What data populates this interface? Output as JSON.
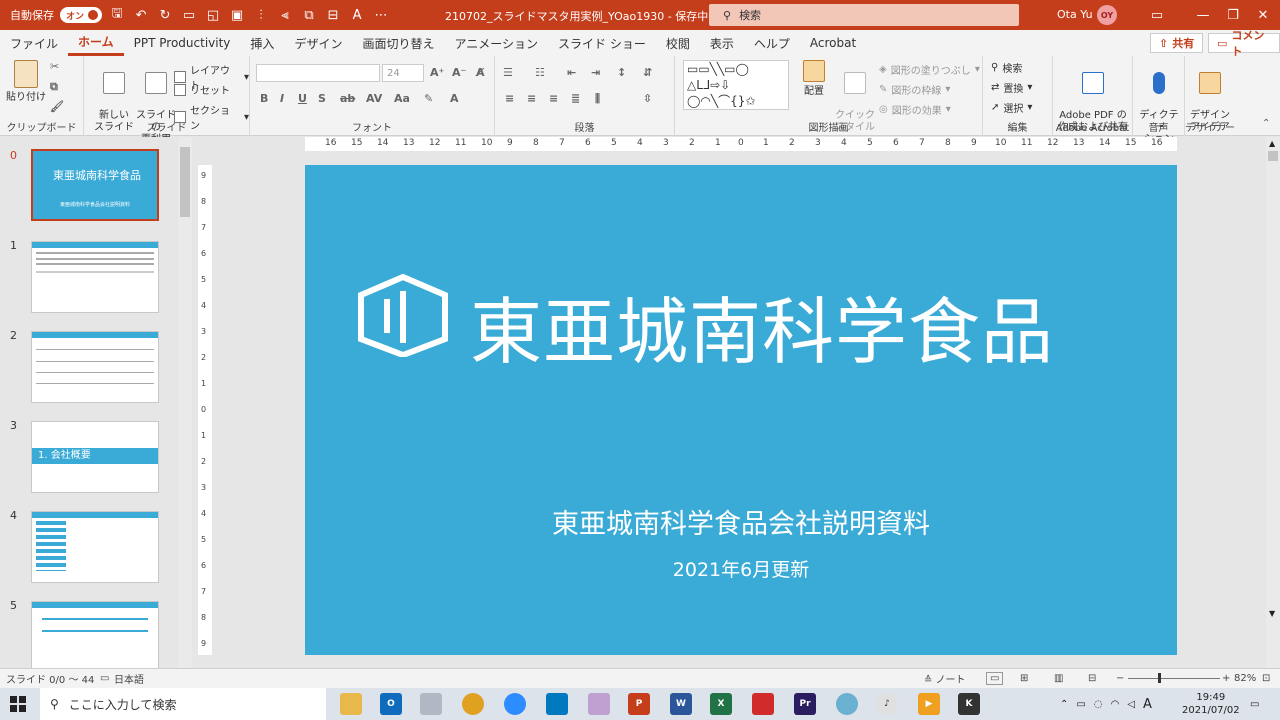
{
  "titlebar": {
    "autosave_label": "自動保存",
    "autosave_state": "オン",
    "doc_title": "210702_スライドマスタ用実例_YOao1930 - 保存中... ▾",
    "search_placeholder": "検索",
    "user_name": "Ota Yu",
    "user_initials": "OY"
  },
  "tabs": [
    "ファイル",
    "ホーム",
    "PPT Productivity",
    "挿入",
    "デザイン",
    "画面切り替え",
    "アニメーション",
    "スライド ショー",
    "校閲",
    "表示",
    "ヘルプ",
    "Acrobat"
  ],
  "share_label": "共有",
  "comment_label": "コメント",
  "ribbon": {
    "clipboard": {
      "paste": "貼り付け",
      "label": "クリップボード"
    },
    "slides": {
      "new_slide": "新しい\nスライド",
      "reuse": "スライドの\n再利用",
      "layout": "レイアウト",
      "reset": "リセット",
      "section": "セクション",
      "label": "スライド"
    },
    "font": {
      "size": "24",
      "label": "フォント"
    },
    "paragraph": {
      "label": "段落"
    },
    "drawing": {
      "arrange": "配置",
      "quick_style": "クイック\nスタイル",
      "fill": "図形の塗りつぶし",
      "outline": "図形の枠線",
      "effect": "図形の効果",
      "label": "図形描画"
    },
    "editing": {
      "find": "検索",
      "replace": "置換",
      "select": "選択",
      "label": "編集"
    },
    "acrobat": {
      "create": "Adobe PDF の\n作成および共有",
      "label": "Adobe Acrobat"
    },
    "voice": {
      "dictate": "ディクテー\nション",
      "label": "音声"
    },
    "designer": {
      "ideas": "デザイン\nアイデア",
      "label": "デザイナー"
    }
  },
  "thumbnails": [
    {
      "num": "0",
      "title": "東亜城南科学食品",
      "sub": "東亜城南科学食品会社説明資料"
    },
    {
      "num": "1"
    },
    {
      "num": "2"
    },
    {
      "num": "3",
      "title": "1. 会社概要"
    },
    {
      "num": "4"
    },
    {
      "num": "5"
    }
  ],
  "ruler_h": [
    "16",
    "15",
    "14",
    "13",
    "12",
    "11",
    "10",
    "9",
    "8",
    "7",
    "6",
    "5",
    "4",
    "3",
    "2",
    "1",
    "0",
    "1",
    "2",
    "3",
    "4",
    "5",
    "6",
    "7",
    "8",
    "9",
    "10",
    "11",
    "12",
    "13",
    "14",
    "15",
    "16"
  ],
  "ruler_v": [
    "9",
    "8",
    "7",
    "6",
    "5",
    "4",
    "3",
    "2",
    "1",
    "0",
    "1",
    "2",
    "3",
    "4",
    "5",
    "6",
    "7",
    "8",
    "9"
  ],
  "slide": {
    "title": "東亜城南科学食品",
    "subtitle": "東亜城南科学食品会社説明資料",
    "date": "2021年6月更新"
  },
  "status": {
    "slide_info": "スライド 0/0 ～ 44",
    "language": "日本語",
    "notes": "ノート",
    "zoom": "82%"
  },
  "taskbar": {
    "search_placeholder": "ここに入力して検索",
    "ime": "A",
    "time": "19:49",
    "date": "2021/07/02"
  },
  "colors": {
    "accent": "#c43e1c",
    "slide_bg": "#3aabd6"
  }
}
